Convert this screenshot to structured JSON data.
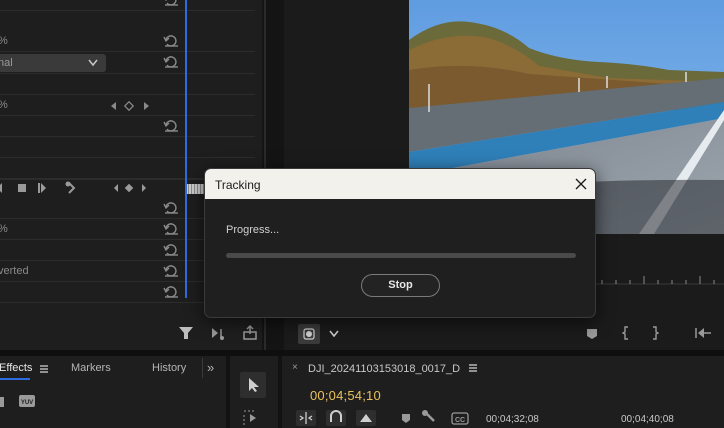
{
  "effect_controls": {
    "row_labels": [
      "%",
      "nal",
      "",
      "%",
      "",
      "",
      "",
      "",
      "%",
      "",
      "verted",
      ""
    ],
    "blend_mode_value": "nal",
    "colors": {
      "accent": "#2d6ce0",
      "panel": "#1e1e1e"
    }
  },
  "tracking_dialog": {
    "title": "Tracking",
    "progress_label": "Progress...",
    "progress_fraction": 0.0,
    "stop_label": "Stop"
  },
  "bottom_tabs": {
    "effects": "Effects",
    "markers": "Markers",
    "history": "History",
    "more": "»"
  },
  "timeline": {
    "close": "×",
    "sequence_name": "DJI_20241103153018_0017_D",
    "current_time": "00;04;54;10",
    "timecode_1": "00;04;32;08",
    "timecode_2": "00;04;40;08"
  },
  "icons": {
    "reset": "reset-icon",
    "filter": "filter-icon",
    "close": "close-icon",
    "selection_tool": "selection-arrow-icon"
  }
}
